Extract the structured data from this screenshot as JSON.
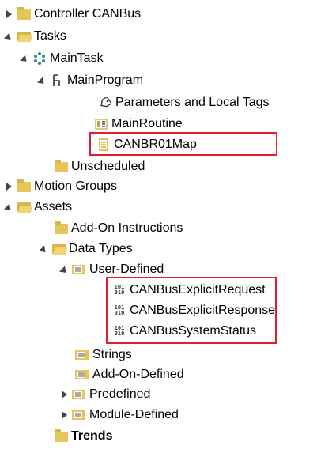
{
  "tree": {
    "controller_canbus": "Controller CANBus",
    "tasks": "Tasks",
    "main_task": "MainTask",
    "main_program": "MainProgram",
    "parameters_local_tags": "Parameters and Local Tags",
    "main_routine": "MainRoutine",
    "canbr01map": "CANBR01Map",
    "unscheduled": "Unscheduled",
    "motion_groups": "Motion Groups",
    "assets": "Assets",
    "addon_instructions": "Add-On Instructions",
    "data_types": "Data Types",
    "user_defined": "User-Defined",
    "canbus_explicit_request": "CANBusExplicitRequest",
    "canbus_explicit_response": "CANBusExplicitResponse",
    "canbus_system_status": "CANBusSystemStatus",
    "strings": "Strings",
    "addon_defined": "Add-On-Defined",
    "predefined": "Predefined",
    "module_defined": "Module-Defined",
    "trends": "Trends",
    "datatype_icon_text": "101\n010"
  },
  "colors": {
    "highlight_border": "#e0202a",
    "folder": "#e8c55a",
    "task_icon": "#2a7fd4"
  }
}
